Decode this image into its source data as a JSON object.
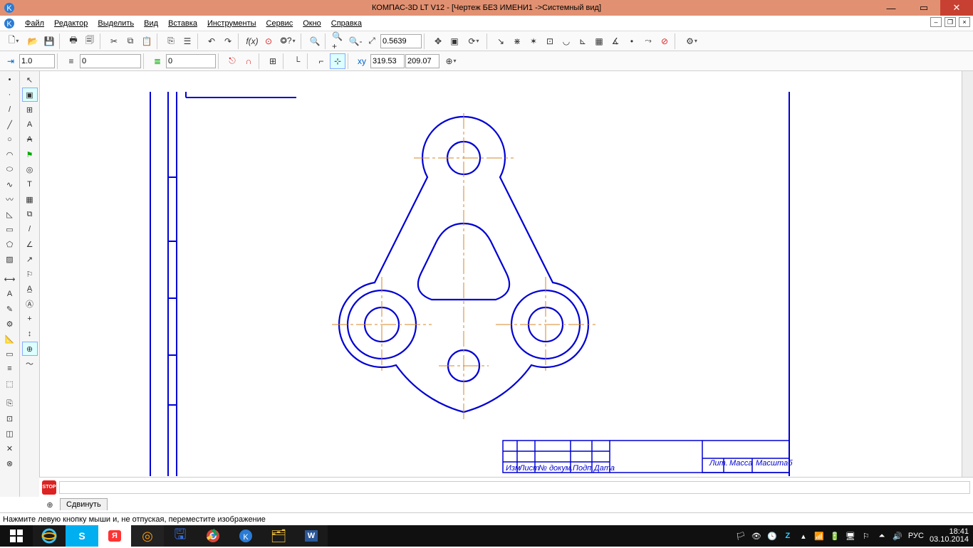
{
  "title": "КОМПАС-3D LT V12 - [Чертеж БЕЗ ИМЕНИ1 ->Системный вид]",
  "menu": {
    "file": "Файл",
    "editor": "Редактор",
    "select": "Выделить",
    "view": "Вид",
    "insert": "Вставка",
    "tools": "Инструменты",
    "service": "Сервис",
    "window": "Окно",
    "help": "Справка"
  },
  "toolbar1": {
    "zoom_value": "0.5639"
  },
  "toolbar2": {
    "step": "1.0",
    "style": "0",
    "layer": "0",
    "coord_x": "319.53",
    "coord_y": "209.07"
  },
  "prop_tab": "Сдвинуть",
  "status_text": "Нажмите левую кнопку мыши и, не отпуская, переместите изображение",
  "tray": {
    "lang": "РУС",
    "time": "18:41",
    "date": "03.10.2014"
  },
  "titleblock": {
    "c1": "Изм",
    "c2": "Лист",
    "c3": "№ докум.",
    "c4": "Подп.",
    "c5": "Дата",
    "h1": "Лит.",
    "h2": "Масса",
    "h3": "Масштаб"
  }
}
